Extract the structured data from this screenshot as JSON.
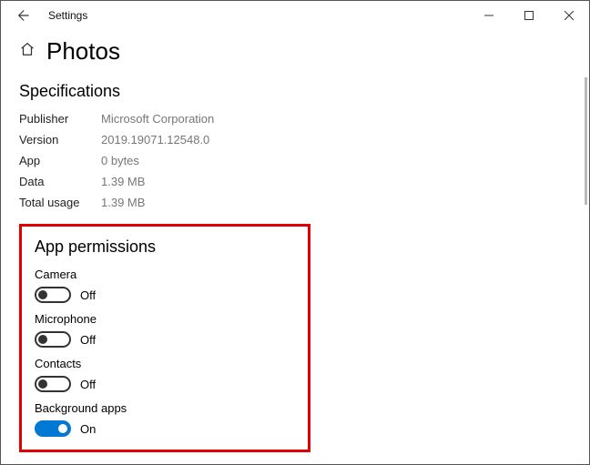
{
  "window": {
    "title": "Settings"
  },
  "page": {
    "title": "Photos"
  },
  "specifications": {
    "heading": "Specifications",
    "rows": [
      {
        "label": "Publisher",
        "value": "Microsoft Corporation"
      },
      {
        "label": "Version",
        "value": "2019.19071.12548.0"
      },
      {
        "label": "App",
        "value": "0 bytes"
      },
      {
        "label": "Data",
        "value": "1.39 MB"
      },
      {
        "label": "Total usage",
        "value": "1.39 MB"
      }
    ]
  },
  "permissions": {
    "heading": "App permissions",
    "items": [
      {
        "label": "Camera",
        "state": "Off",
        "on": false
      },
      {
        "label": "Microphone",
        "state": "Off",
        "on": false
      },
      {
        "label": "Contacts",
        "state": "Off",
        "on": false
      },
      {
        "label": "Background apps",
        "state": "On",
        "on": true
      }
    ]
  }
}
